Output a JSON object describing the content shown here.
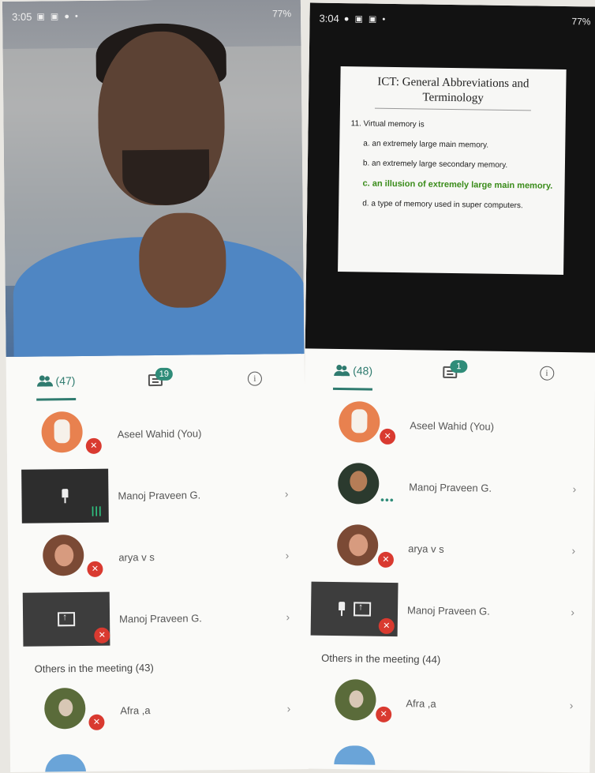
{
  "left": {
    "status": {
      "time": "3:05",
      "battery": "77%"
    },
    "tabs": {
      "people_count": "(47)",
      "chat_badge": "19"
    },
    "participants": [
      {
        "name": "Aseel Wahid (You)"
      },
      {
        "name": "Manoj Praveen G."
      },
      {
        "name": "arya v s"
      },
      {
        "name": "Manoj Praveen G."
      }
    ],
    "others_title": "Others in the meeting (43)",
    "others": [
      {
        "name": "Afra ,a"
      }
    ]
  },
  "right": {
    "status": {
      "time": "3:04",
      "battery": "77%"
    },
    "slide": {
      "title": "ICT: General Abbreviations and Terminology",
      "question": "11. Virtual memory is",
      "options": [
        "a. an extremely large main memory.",
        "b. an extremely large secondary memory.",
        "c. an illusion of extremely large main memory.",
        "d. a type of memory used in super computers."
      ]
    },
    "tabs": {
      "people_count": "(48)",
      "chat_badge": "1"
    },
    "participants": [
      {
        "name": "Aseel Wahid (You)"
      },
      {
        "name": "Manoj Praveen G."
      },
      {
        "name": "arya v s"
      },
      {
        "name": "Manoj Praveen G."
      }
    ],
    "others_title": "Others in the meeting (44)",
    "others": [
      {
        "name": "Afra ,a"
      }
    ]
  },
  "icons": {
    "people": "people-icon",
    "chat": "chat-icon",
    "info": "info-icon",
    "mute": "mic-off-icon",
    "pin": "pin-icon",
    "present": "present-screen-icon",
    "chevron": "chevron-right-icon"
  },
  "colors": {
    "accent": "#2f7b6f",
    "mute": "#d93a30",
    "audio": "#2fbf7f"
  }
}
